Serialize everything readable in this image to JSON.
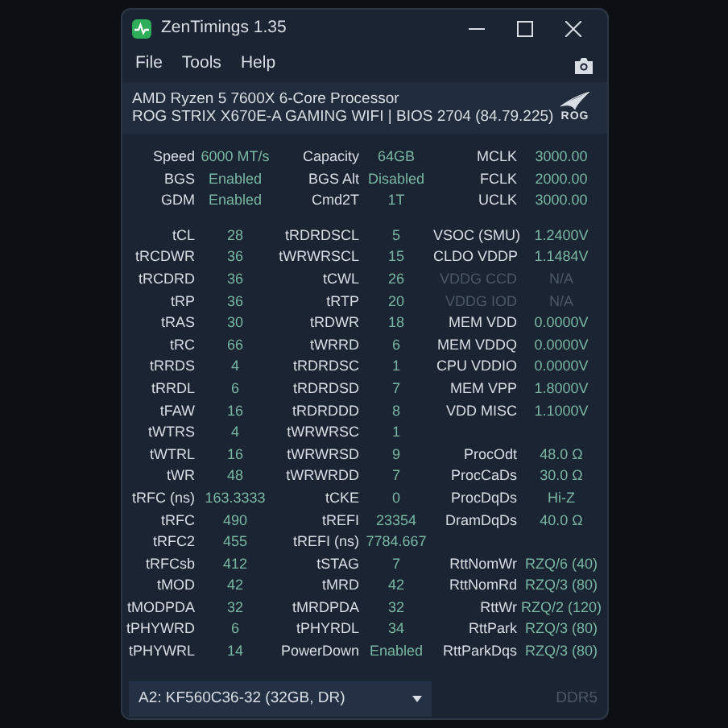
{
  "window": {
    "title": "ZenTimings 1.35"
  },
  "menu": [
    "File",
    "Tools",
    "Help"
  ],
  "system": {
    "cpu": "AMD Ryzen 5 7600X 6-Core Processor",
    "board": "ROG STRIX X670E-A GAMING WIFI | BIOS 2704 (84.79.225)",
    "logo_text": "ROG"
  },
  "summary": [
    {
      "cells": [
        {
          "label": "Speed",
          "value": "6000 MT/s"
        },
        {
          "label": "Capacity",
          "value": "64GB"
        },
        {
          "label": "MCLK",
          "value": "3000.00"
        }
      ]
    },
    {
      "cells": [
        {
          "label": "BGS",
          "value": "Enabled"
        },
        {
          "label": "BGS Alt",
          "value": "Disabled"
        },
        {
          "label": "FCLK",
          "value": "2000.00"
        }
      ]
    },
    {
      "cells": [
        {
          "label": "GDM",
          "value": "Enabled"
        },
        {
          "label": "Cmd2T",
          "value": "1T"
        },
        {
          "label": "UCLK",
          "value": "3000.00"
        }
      ]
    }
  ],
  "timings": [
    {
      "left": {
        "label": "tCL",
        "value": "28"
      },
      "middle": {
        "label": "tRDRDSCL",
        "value": "5"
      },
      "right": {
        "label": "VSOC (SMU)",
        "value": "1.2400V",
        "disabled": false
      }
    },
    {
      "left": {
        "label": "tRCDWR",
        "value": "36"
      },
      "middle": {
        "label": "tWRWRSCL",
        "value": "15"
      },
      "right": {
        "label": "CLDO VDDP",
        "value": "1.1484V",
        "disabled": false
      }
    },
    {
      "left": {
        "label": "tRCDRD",
        "value": "36"
      },
      "middle": {
        "label": "tCWL",
        "value": "26"
      },
      "right": {
        "label": "VDDG CCD",
        "value": "N/A",
        "disabled": true
      }
    },
    {
      "left": {
        "label": "tRP",
        "value": "36"
      },
      "middle": {
        "label": "tRTP",
        "value": "20"
      },
      "right": {
        "label": "VDDG IOD",
        "value": "N/A",
        "disabled": true
      }
    },
    {
      "left": {
        "label": "tRAS",
        "value": "30"
      },
      "middle": {
        "label": "tRDWR",
        "value": "18"
      },
      "right": {
        "label": "MEM VDD",
        "value": "0.0000V",
        "disabled": false
      }
    },
    {
      "left": {
        "label": "tRC",
        "value": "66"
      },
      "middle": {
        "label": "tWRRD",
        "value": "6"
      },
      "right": {
        "label": "MEM VDDQ",
        "value": "0.0000V",
        "disabled": false
      }
    },
    {
      "left": {
        "label": "tRRDS",
        "value": "4"
      },
      "middle": {
        "label": "tRDRDSC",
        "value": "1"
      },
      "right": {
        "label": "CPU VDDIO",
        "value": "0.0000V",
        "disabled": false
      }
    },
    {
      "left": {
        "label": "tRRDL",
        "value": "6"
      },
      "middle": {
        "label": "tRDRDSD",
        "value": "7"
      },
      "right": {
        "label": "MEM VPP",
        "value": "1.8000V",
        "disabled": false
      }
    },
    {
      "left": {
        "label": "tFAW",
        "value": "16"
      },
      "middle": {
        "label": "tRDRDDD",
        "value": "8"
      },
      "right": {
        "label": "VDD MISC",
        "value": "1.1000V",
        "disabled": false
      }
    },
    {
      "left": {
        "label": "tWTRS",
        "value": "4"
      },
      "middle": {
        "label": "tWRWRSC",
        "value": "1"
      }
    },
    {
      "left": {
        "label": "tWTRL",
        "value": "16"
      },
      "middle": {
        "label": "tWRWRSD",
        "value": "9"
      },
      "right": {
        "label": "ProcOdt",
        "value": "48.0 Ω",
        "disabled": false
      }
    },
    {
      "left": {
        "label": "tWR",
        "value": "48"
      },
      "middle": {
        "label": "tWRWRDD",
        "value": "7"
      },
      "right": {
        "label": "ProcCaDs",
        "value": "30.0 Ω",
        "disabled": false
      }
    },
    {
      "left": {
        "label": "tRFC (ns)",
        "value": "163.3333"
      },
      "middle": {
        "label": "tCKE",
        "value": "0"
      },
      "right": {
        "label": "ProcDqDs",
        "value": "Hi-Z",
        "disabled": false
      }
    },
    {
      "left": {
        "label": "tRFC",
        "value": "490"
      },
      "middle": {
        "label": "tREFI",
        "value": "23354"
      },
      "right": {
        "label": "DramDqDs",
        "value": "40.0 Ω",
        "disabled": false
      }
    },
    {
      "left": {
        "label": "tRFC2",
        "value": "455"
      },
      "middle": {
        "label": "tREFI (ns)",
        "value": "7784.667"
      }
    },
    {
      "left": {
        "label": "tRFCsb",
        "value": "412"
      },
      "middle": {
        "label": "tSTAG",
        "value": "7"
      },
      "right": {
        "label": "RttNomWr",
        "value": "RZQ/6 (40)",
        "disabled": false
      }
    },
    {
      "left": {
        "label": "tMOD",
        "value": "42"
      },
      "middle": {
        "label": "tMRD",
        "value": "42"
      },
      "right": {
        "label": "RttNomRd",
        "value": "RZQ/3 (80)",
        "disabled": false
      }
    },
    {
      "left": {
        "label": "tMODPDA",
        "value": "32"
      },
      "middle": {
        "label": "tMRDPDA",
        "value": "32"
      },
      "right": {
        "label": "RttWr",
        "value": "RZQ/2 (120)",
        "disabled": false
      }
    },
    {
      "left": {
        "label": "tPHYWRD",
        "value": "6"
      },
      "middle": {
        "label": "tPHYRDL",
        "value": "34"
      },
      "right": {
        "label": "RttPark",
        "value": "RZQ/3 (80)",
        "disabled": false
      }
    },
    {
      "left": {
        "label": "tPHYWRL",
        "value": "14"
      },
      "middle": {
        "label": "PowerDown",
        "value": "Enabled"
      },
      "right": {
        "label": "RttParkDqs",
        "value": "RZQ/3 (80)",
        "disabled": false
      }
    }
  ],
  "footer": {
    "module": "A2: KF560C36-32 (32GB, DR)",
    "memory_type": "DDR5"
  }
}
